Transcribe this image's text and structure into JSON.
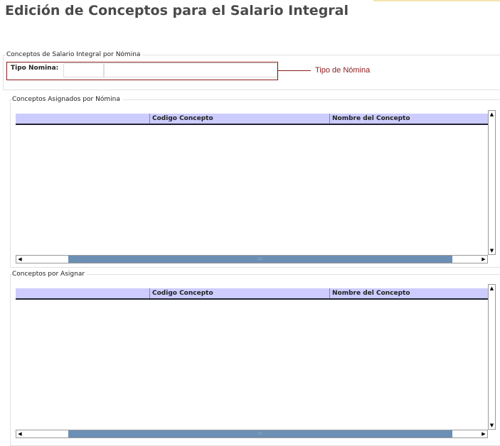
{
  "title": "Edición de Conceptos para el Salario Integral",
  "section1": {
    "legend": "Conceptos de Salario Integral por Nómina",
    "tipo_nomina_label": "Tipo Nomina:",
    "code_value": "",
    "name_value": "",
    "annotation": "Tipo de Nómina"
  },
  "grid1": {
    "legend": "Conceptos Asignados por Nómina",
    "columns": [
      "",
      "Codigo Concepto",
      "Nombre del Concepto"
    ],
    "rows": []
  },
  "grid2": {
    "legend": "Conceptos por Asignar",
    "columns": [
      "",
      "Codigo Concepto",
      "Nombre del Concepto"
    ],
    "rows": []
  },
  "icons": {
    "up": "▲",
    "down": "▼",
    "left": "◀",
    "right": "▶",
    "grip": ":::"
  }
}
